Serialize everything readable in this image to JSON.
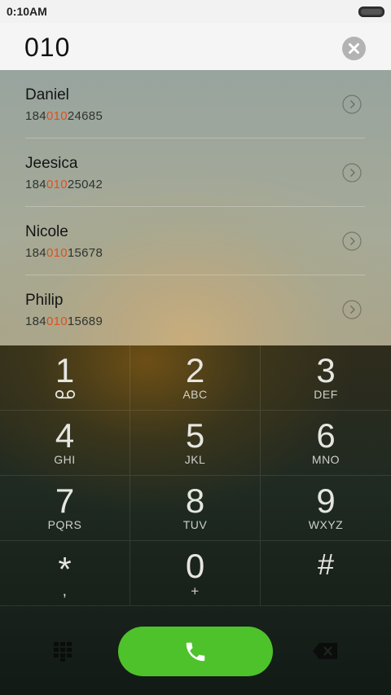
{
  "status_bar": {
    "time": "0:10AM"
  },
  "dial": {
    "number": "010"
  },
  "contacts": [
    {
      "name": "Daniel",
      "number_prefix": "184",
      "number_match": "010",
      "number_suffix": "24685"
    },
    {
      "name": "Jeesica",
      "number_prefix": "184",
      "number_match": "010",
      "number_suffix": "25042"
    },
    {
      "name": "Nicole",
      "number_prefix": "184",
      "number_match": "010",
      "number_suffix": "15678"
    },
    {
      "name": "Philip",
      "number_prefix": "184",
      "number_match": "010",
      "number_suffix": "15689"
    }
  ],
  "keypad": [
    {
      "digit": "1",
      "letters": "",
      "icon": "voicemail-icon"
    },
    {
      "digit": "2",
      "letters": "ABC"
    },
    {
      "digit": "3",
      "letters": "DEF"
    },
    {
      "digit": "4",
      "letters": "GHI"
    },
    {
      "digit": "5",
      "letters": "JKL"
    },
    {
      "digit": "6",
      "letters": "MNO"
    },
    {
      "digit": "7",
      "letters": "PQRS"
    },
    {
      "digit": "8",
      "letters": "TUV"
    },
    {
      "digit": "9",
      "letters": "WXYZ"
    },
    {
      "digit": "*",
      "letters": ","
    },
    {
      "digit": "0",
      "letters": "+"
    },
    {
      "digit": "#",
      "letters": ""
    }
  ],
  "colors": {
    "match_highlight": "#e0501a",
    "call_button": "#4ec22a"
  },
  "icons": {
    "battery": "battery-icon",
    "clear": "close-icon",
    "contact_detail": "chevron-right-circle-icon",
    "dialpad": "dialpad-grid-icon",
    "call": "phone-icon",
    "backspace": "backspace-icon"
  }
}
